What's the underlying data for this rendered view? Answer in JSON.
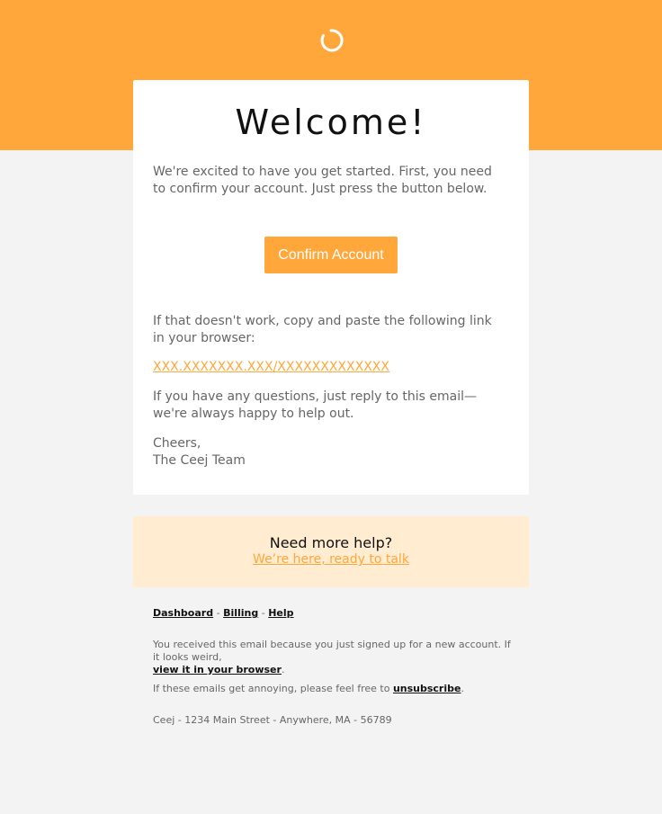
{
  "colors": {
    "accent": "#ffa73b",
    "accent_light": "#ffecd1",
    "background": "#f3f3f3",
    "card": "#ffffff",
    "text": "#666666",
    "heading": "#111111"
  },
  "header": {
    "logo_icon": "spinner-ring-icon"
  },
  "card": {
    "title": "Welcome!",
    "intro": "We're excited to have you get started. First, you need to confirm your account. Just press the button below.",
    "button_label": "Confirm Account",
    "fallback_text": "If that doesn't work, copy and paste the following link in your browser:",
    "fallback_link": "XXX.XXXXXXX.XXX/XXXXXXXXXXXXX",
    "questions_text": "If you have any questions, just reply to this email—we're always happy to help out.",
    "signoff": "Cheers,",
    "signature": "The Ceej Team"
  },
  "help": {
    "title": "Need more help?",
    "link": "We’re here, ready to talk"
  },
  "footer": {
    "nav": {
      "dashboard": "Dashboard",
      "billing": "Billing",
      "help": "Help",
      "separator": " - "
    },
    "reason_text": "You received this email because you just signed up for a new account. If it looks weird,",
    "view_in_browser": "view it in your browser",
    "period": ".",
    "unsubscribe_text": "If these emails get annoying, please feel free to",
    "unsubscribe_link": "unsubscribe",
    "address": "Ceej - 1234 Main Street - Anywhere, MA - 56789"
  }
}
